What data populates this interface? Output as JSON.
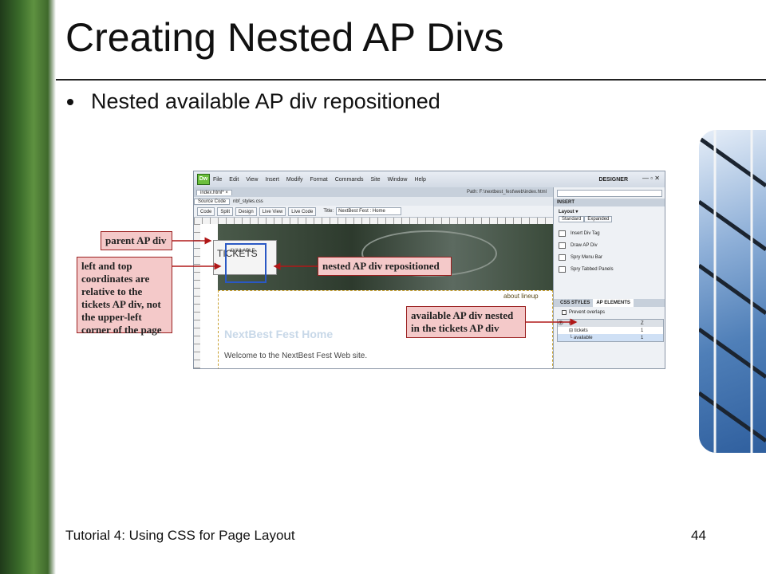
{
  "slide": {
    "title": "Creating Nested AP Divs",
    "bullet": "Nested available AP div repositioned",
    "footer": "Tutorial 4: Using CSS for Page Layout",
    "page_number": "44"
  },
  "app": {
    "logo": "Dw",
    "menu": [
      "File",
      "Edit",
      "View",
      "Insert",
      "Modify",
      "Format",
      "Commands",
      "Site",
      "Window",
      "Help"
    ],
    "workspace": "DESIGNER",
    "window_buttons": "— ▫ ✕",
    "doc_tab": "index.html*",
    "doc_tab_close": "×",
    "path": "Path: F:\\nextbest_fest\\web\\index.html",
    "related_files": [
      "Source Code",
      "nbf_styles.css"
    ],
    "view_buttons": [
      "Code",
      "Split",
      "Design",
      "Live View",
      "Live Code"
    ],
    "title_label": "Title:",
    "title_value": "NextBest Fest : Home"
  },
  "design_view": {
    "tickets_label": "TICKETS",
    "available_label": "AVAILABLE",
    "nav_text": "about  lineup",
    "heading": "NextBest Fest Home",
    "welcome": "Welcome to the NextBest Fest Web site."
  },
  "panel": {
    "insert_header": "INSERT",
    "layout_label": "Layout ▾",
    "tabs": [
      "Standard",
      "Expanded"
    ],
    "items": [
      "Insert Div Tag",
      "Draw AP Div",
      "Spry Menu Bar",
      "Spry Tabbed Panels"
    ],
    "css_tabs": [
      "CSS STYLES",
      "AP ELEMENTS"
    ],
    "prevent_overlaps": "Prevent overlaps",
    "table_headers": [
      "ID",
      "Z"
    ],
    "rows": [
      {
        "id": "⊟ tickets",
        "z": "1"
      },
      {
        "id": "└ available",
        "z": "1"
      }
    ]
  },
  "callouts": {
    "parent": "parent AP div",
    "coords": "left and top coordinates are relative to the tickets AP div, not the upper-left corner of the page",
    "nested": "nested AP div repositioned",
    "available": "available AP div nested in the tickets AP div"
  },
  "colors": {
    "callout_fill": "#f4c9c9",
    "callout_border": "#9a2020",
    "selection_blue": "#2a58c4"
  }
}
